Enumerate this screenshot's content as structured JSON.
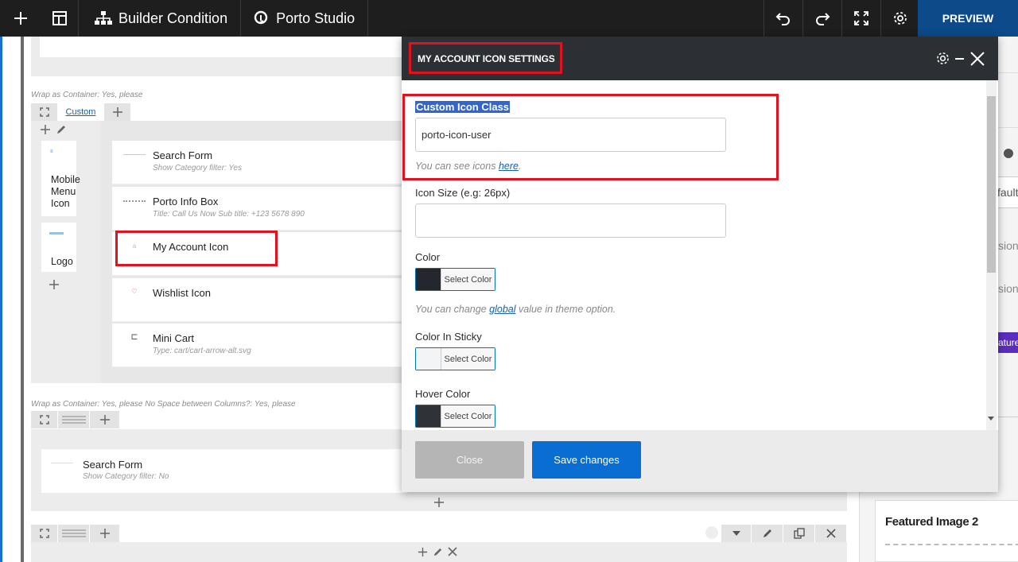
{
  "toolbar": {
    "builder_condition": "Builder Condition",
    "porto_studio": "Porto Studio",
    "preview": "PREVIEW"
  },
  "canvas": {
    "wrap_meta_1": "Wrap as Container: Yes, please",
    "custom_tab": "Custom",
    "mobile_menu_icon": "Mobile Menu Icon",
    "logo": "Logo",
    "elements": [
      {
        "title": "Search Form",
        "subtitle": "Show Category filter: Yes"
      },
      {
        "title": "Porto Info Box",
        "subtitle": "Title: Call Us Now  Sub title: +123 5678 890"
      },
      {
        "title": "My Account Icon",
        "subtitle": ""
      },
      {
        "title": "Wishlist Icon",
        "subtitle": ""
      },
      {
        "title": "Mini Cart",
        "subtitle": "Type: cart/cart-arrow-alt.svg"
      }
    ],
    "wrap_meta_2": "Wrap as Container: Yes, please  No Space between Columns?: Yes, please",
    "search_form_2": {
      "title": "Search Form",
      "subtitle": "Show Category filter: No"
    }
  },
  "right_panel": {
    "partial_1": "fault",
    "partial_2": "sion",
    "partial_3": "sion",
    "partial_badge": "ature",
    "featured_image": "Featured Image 2"
  },
  "modal": {
    "title": "MY ACCOUNT ICON SETTINGS",
    "custom_icon_class_label": "Custom Icon Class",
    "custom_icon_class_value": "porto-icon-user",
    "icons_help_prefix": "You can see icons ",
    "icons_help_link": "here",
    "icons_help_suffix": ".",
    "icon_size_label": "Icon Size (e.g: 26px)",
    "icon_size_value": "",
    "color_label": "Color",
    "select_color": "Select Color",
    "global_help_prefix": "You can change ",
    "global_help_link": "global",
    "global_help_suffix": " value in theme option.",
    "color_sticky_label": "Color In Sticky",
    "hover_color_label": "Hover Color",
    "close_button": "Close",
    "save_button": "Save changes"
  },
  "colors": {
    "color_swatch": "#23272e",
    "sticky_swatch": "#f2f4f5",
    "hover_swatch": "#2f3338",
    "accent": "#0a6dd1",
    "highlight_red": "#e0121f"
  }
}
